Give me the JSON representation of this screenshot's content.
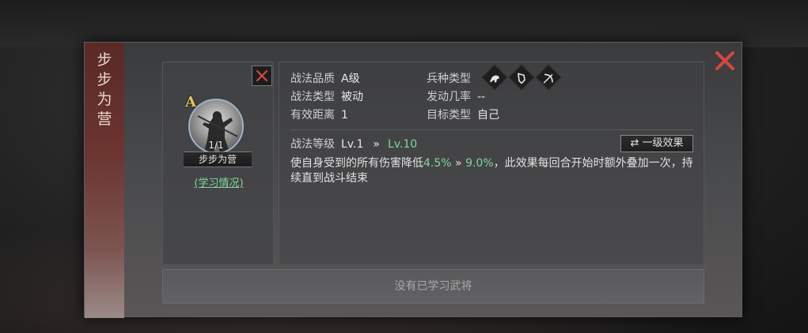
{
  "skill": {
    "side_title": "步步为营",
    "grade_badge": "A",
    "level_count": "1/1",
    "name": "步步为营",
    "learn_link": "(学习情况)"
  },
  "info": {
    "quality_label": "战法品质",
    "quality_value": "A级",
    "type_label": "战法类型",
    "type_value": "被动",
    "range_label": "有效距离",
    "range_value": "1",
    "troop_label": "兵种类型",
    "troop_icons": [
      "cavalry-icon",
      "shield-icon",
      "bow-icon"
    ],
    "trigger_label": "发动几率",
    "trigger_value": "--",
    "target_label": "目标类型",
    "target_value": "自己",
    "level_label": "战法等级",
    "level_from": "Lv.1",
    "level_arrow": "»",
    "level_to": "Lv.10",
    "effect_button": "一级效果",
    "desc_part1": "使自身受到的所有伤害降低",
    "desc_val1": "4.5%",
    "desc_arrow": "»",
    "desc_val2": "9.0%",
    "desc_part2": "，此效果每回合开始时额外叠加一次，持续直到战斗结束"
  },
  "bottom": {
    "text": "没有已学习武将"
  },
  "colors": {
    "accent_green": "#7fd89a",
    "grade_gold": "#e8c45a",
    "close_red": "#d9473f"
  }
}
